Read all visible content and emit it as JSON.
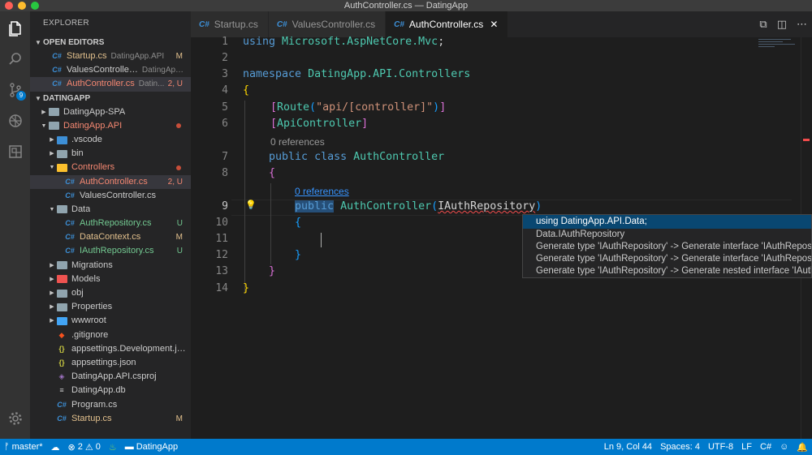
{
  "window": {
    "title": "AuthController.cs — DatingApp"
  },
  "activity": {
    "scm_badge": "9"
  },
  "sidebar": {
    "header": "EXPLORER",
    "open_editors_label": "OPEN EDITORS",
    "open_editors": [
      {
        "name": "Startup.cs",
        "desc": "DatingApp.API",
        "status": "M"
      },
      {
        "name": "ValuesController.cs",
        "desc": "DatingApp....",
        "status": ""
      },
      {
        "name": "AuthController.cs",
        "desc": "Datin...",
        "status": "2, U"
      }
    ],
    "workspace_label": "DATINGAPP",
    "tree": [
      {
        "name": "DatingApp-SPA",
        "status": ""
      },
      {
        "name": "DatingApp.API",
        "status": ""
      },
      {
        "name": ".vscode",
        "status": ""
      },
      {
        "name": "bin",
        "status": ""
      },
      {
        "name": "Controllers",
        "status": ""
      },
      {
        "name": "AuthController.cs",
        "status": "2, U"
      },
      {
        "name": "ValuesController.cs",
        "status": ""
      },
      {
        "name": "Data",
        "status": ""
      },
      {
        "name": "AuthRepository.cs",
        "status": "U"
      },
      {
        "name": "DataContext.cs",
        "status": "M"
      },
      {
        "name": "IAuthRepository.cs",
        "status": "U"
      },
      {
        "name": "Migrations",
        "status": ""
      },
      {
        "name": "Models",
        "status": ""
      },
      {
        "name": "obj",
        "status": ""
      },
      {
        "name": "Properties",
        "status": ""
      },
      {
        "name": "wwwroot",
        "status": ""
      },
      {
        "name": ".gitignore",
        "status": ""
      },
      {
        "name": "appsettings.Development.js...",
        "status": ""
      },
      {
        "name": "appsettings.json",
        "status": ""
      },
      {
        "name": "DatingApp.API.csproj",
        "status": ""
      },
      {
        "name": "DatingApp.db",
        "status": ""
      },
      {
        "name": "Program.cs",
        "status": ""
      },
      {
        "name": "Startup.cs",
        "status": "M"
      }
    ]
  },
  "tabs": [
    {
      "label": "Startup.cs"
    },
    {
      "label": "ValuesController.cs"
    },
    {
      "label": "AuthController.cs"
    }
  ],
  "editor": {
    "line_numbers": [
      "1",
      "2",
      "3",
      "4",
      "5",
      "6",
      "7",
      "8",
      "9",
      "10",
      "11",
      "12",
      "13",
      "14"
    ],
    "code": {
      "l1_kw": "using",
      "l1_ns": "Microsoft.AspNetCore.Mvc",
      "l1_semi": ";",
      "l3_kw": "namespace",
      "l3_ns": "DatingApp.API.Controllers",
      "l4": "{",
      "l5_open": "[",
      "l5_attr": "Route",
      "l5_paren_open": "(",
      "l5_str": "\"api/[controller]\"",
      "l5_paren_close": ")",
      "l5_close": "]",
      "l6_open": "[",
      "l6_attr": "ApiController",
      "l6_close": "]",
      "l7_kw1": "public",
      "l7_kw2": "class",
      "l7_name": "AuthController",
      "l8": "{",
      "l9_kw": "public",
      "l9_name": "AuthController",
      "l9_open": "(",
      "l9_type": "IAuthRepository",
      "l9_close": ")",
      "l10": "{",
      "l12": "}",
      "l13": "}",
      "l14": "}"
    },
    "codelens_class": "0 references",
    "codelens_ctor": "0 references"
  },
  "suggestions": [
    "using DatingApp.API.Data;",
    "Data.IAuthRepository",
    "Generate type 'IAuthRepository' -> Generate interface 'IAuthReposi",
    "Generate type 'IAuthRepository' -> Generate interface 'IAuthReposi",
    "Generate type 'IAuthRepository' -> Generate nested interface 'IAuth"
  ],
  "status": {
    "branch": "master*",
    "errors": "2",
    "warnings": "0",
    "project": "DatingApp",
    "position": "Ln 9, Col 44",
    "spaces": "Spaces: 4",
    "encoding": "UTF-8",
    "eol": "LF",
    "language": "C#"
  },
  "colors": {
    "accent": "#007acc",
    "modified": "#e2c08d",
    "error": "#f48771",
    "untracked": "#73c991"
  }
}
